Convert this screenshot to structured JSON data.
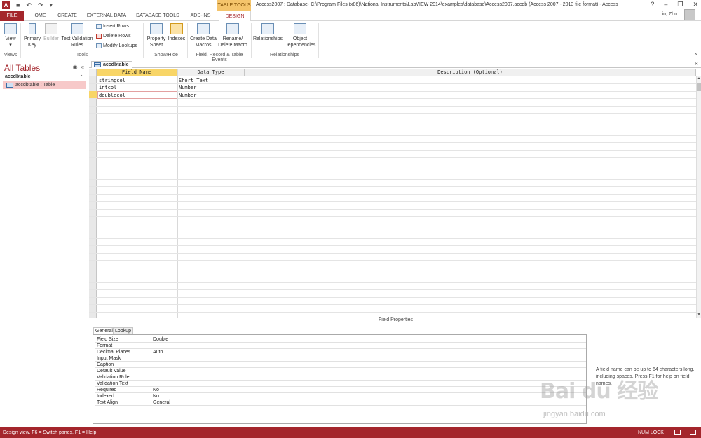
{
  "window": {
    "title": "Access2007 : Database- C:\\Program Files (x86)\\National Instruments\\LabVIEW 2014\\examples\\database\\Access2007.accdb (Access 2007 - 2013 file format) - Access",
    "contextual_tab_group": "TABLE TOOLS",
    "user": "Liu, Zhu",
    "help_glyph": "?"
  },
  "tabs": [
    "FILE",
    "HOME",
    "CREATE",
    "EXTERNAL DATA",
    "DATABASE TOOLS",
    "ADD-INS",
    "DESIGN"
  ],
  "ribbon": {
    "view": {
      "label": "View",
      "caret": "▾"
    },
    "primary_key": "Primary Key",
    "builder": "Builder",
    "test_validation_rules": "Test Validation Rules",
    "insert_rows": "Insert Rows",
    "delete_rows": "Delete Rows",
    "modify_lookups": "Modify Lookups",
    "property_sheet": "Property Sheet",
    "indexes": "Indexes",
    "create_data_macros": "Create Data Macros",
    "rename_delete_macro": "Rename/ Delete Macro",
    "relationships": "Relationships",
    "object_dependencies": "Object Dependencies",
    "groups": [
      "Views",
      "Tools",
      "Show/Hide",
      "Field, Record & Table Events",
      "Relationships"
    ]
  },
  "nav": {
    "title": "All Tables",
    "group": "accdbtable",
    "items": [
      {
        "label": "accdbtable : Table"
      }
    ]
  },
  "document": {
    "tab_label": "accdbtable",
    "columns": [
      "Field Name",
      "Data Type",
      "Description (Optional)"
    ],
    "rows": [
      {
        "field": "stringcol",
        "type": "Short Text",
        "desc": ""
      },
      {
        "field": "intcol",
        "type": "Number",
        "desc": ""
      },
      {
        "field": "doublecol",
        "type": "Number",
        "desc": ""
      }
    ]
  },
  "field_properties": {
    "section_label": "Field Properties",
    "tabs": [
      "General",
      "Lookup"
    ],
    "rows": [
      {
        "k": "Field Size",
        "v": "Double"
      },
      {
        "k": "Format",
        "v": ""
      },
      {
        "k": "Decimal Places",
        "v": "Auto"
      },
      {
        "k": "Input Mask",
        "v": ""
      },
      {
        "k": "Caption",
        "v": ""
      },
      {
        "k": "Default Value",
        "v": ""
      },
      {
        "k": "Validation Rule",
        "v": ""
      },
      {
        "k": "Validation Text",
        "v": ""
      },
      {
        "k": "Required",
        "v": "No"
      },
      {
        "k": "Indexed",
        "v": "No"
      },
      {
        "k": "Text Align",
        "v": "General"
      }
    ],
    "help_text": "A field name can be up to 64 characters long, including spaces. Press F1 for help on field names."
  },
  "status": {
    "left": "Design view.  F6 = Switch panes.  F1 = Help.",
    "num_lock": "NUM LOCK"
  },
  "watermark": {
    "brand": "Bai du 经验",
    "url": "jingyan.baidu.com"
  },
  "colors": {
    "accent": "#a4262c",
    "contextual": "#f4c46b",
    "active_row": "#f8d567",
    "nav_selected": "#f7c9c9"
  }
}
